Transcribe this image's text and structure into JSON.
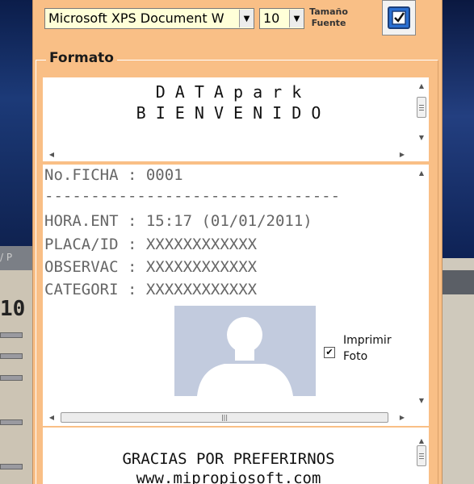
{
  "background": {
    "left_number": "10",
    "left_snippet": "/ P"
  },
  "toolbar": {
    "font_value": "Microsoft XPS Document W",
    "size_value": "10",
    "size_label": "Tamaño Fuente",
    "apply_icon": "check-icon"
  },
  "formato": {
    "legend": "Formato",
    "header": {
      "line1": "D A T A p a r k",
      "line2": "B I E N V E N I D O"
    },
    "ticket": {
      "ficha": "No.FICHA : 0001",
      "divider": "--------------------------------",
      "hora": "HORA.ENT : 15:17 (01/01/2011)",
      "placa": "PLACA/ID : XXXXXXXXXXXX",
      "observ": "OBSERVAC : XXXXXXXXXXXX",
      "categ": "CATEGORI : XXXXXXXXXXXX",
      "print_photo_label": "Imprimir Foto",
      "print_photo_checked": true
    },
    "footer": {
      "line1": "GRACIAS POR PREFERIRNOS",
      "line2": "www.mipropiosoft.com"
    }
  },
  "colors": {
    "window_bg": "#f9bf86",
    "input_bg": "#ffffd8",
    "photo_bg": "#c2cbde",
    "accent": "#2a6fd1"
  }
}
